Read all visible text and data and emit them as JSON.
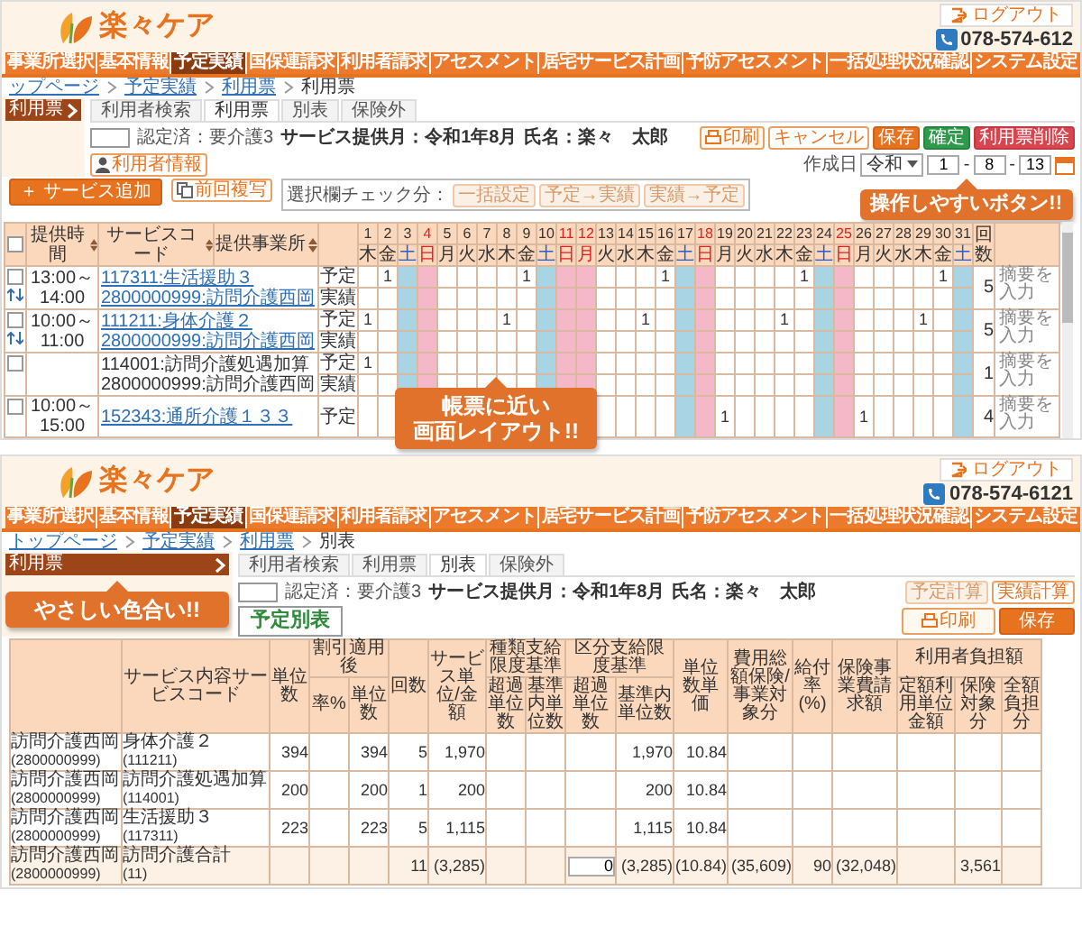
{
  "top_screen": {
    "header": {
      "logo_text": "楽々ケア",
      "logout": "ログアウト",
      "phone": "078-574-612"
    },
    "nav": [
      {
        "label": "事業所選択",
        "selected": false
      },
      {
        "label": "基本情報",
        "selected": false
      },
      {
        "label": "予定実績",
        "selected": true
      },
      {
        "label": "国保連請求",
        "selected": false
      },
      {
        "label": "利用者請求",
        "selected": false
      },
      {
        "label": "アセスメント",
        "selected": false
      },
      {
        "label": "居宅サービス計画",
        "selected": false
      },
      {
        "label": "予防アセスメント",
        "selected": false
      },
      {
        "label": "一括処理状況確認",
        "selected": false
      },
      {
        "label": "システム設定",
        "selected": false
      }
    ],
    "breadcrumb": [
      {
        "label": "ップページ",
        "link": true
      },
      {
        "label": "予定実績",
        "link": true
      },
      {
        "label": "利用票",
        "link": true
      },
      {
        "label": "利用票",
        "link": false
      }
    ],
    "sidebar": {
      "items": [
        {
          "label": "利用票",
          "selected": true
        }
      ]
    },
    "tabs": [
      {
        "label": "利用者検索",
        "selected": false
      },
      {
        "label": "利用票",
        "selected": true
      },
      {
        "label": "別表",
        "selected": false
      },
      {
        "label": "保険外",
        "selected": false
      }
    ],
    "info": {
      "status": "認定済：要介護3",
      "month": "サービス提供月：令和1年8月",
      "name": "氏名：楽々　太郎"
    },
    "buttons": [
      {
        "label": "印刷",
        "kind": "print"
      },
      {
        "label": "キャンセル",
        "kind": "outline"
      },
      {
        "label": "保存",
        "kind": "primary"
      },
      {
        "label": "確定",
        "kind": "confirm"
      },
      {
        "label": "利用票削除",
        "kind": "danger"
      }
    ],
    "user_info_button": "利用者情報",
    "created_date": {
      "label": "作成日",
      "parts": [
        {
          "kind": "select",
          "value": "令和"
        },
        {
          "kind": "field",
          "value": "1"
        },
        {
          "kind": "sep",
          "value": "-"
        },
        {
          "kind": "field",
          "value": "8"
        },
        {
          "kind": "sep",
          "value": "-"
        },
        {
          "kind": "field",
          "value": "13"
        }
      ]
    },
    "toolbar": {
      "add_button": "＋ サービス追加",
      "copy_button": "前回複写",
      "check_label": "選択欄チェック分：",
      "check_buttons": [
        "一括設定",
        "予定→実績",
        "実績→予定"
      ]
    },
    "button_callout": "操作しやすいボタン!!",
    "table": {
      "select_all_checked": false,
      "columns": [
        "提供時間",
        "サービスコード",
        "提供事業所"
      ],
      "count_header": "回数",
      "days": [
        {
          "day": "1",
          "weekday": "木",
          "kind": "weekday"
        },
        {
          "day": "2",
          "weekday": "金",
          "kind": "weekday"
        },
        {
          "day": "3",
          "weekday": "土",
          "kind": "saturday"
        },
        {
          "day": "4",
          "weekday": "日",
          "kind": "holiday"
        },
        {
          "day": "5",
          "weekday": "月",
          "kind": "weekday"
        },
        {
          "day": "6",
          "weekday": "火",
          "kind": "weekday"
        },
        {
          "day": "7",
          "weekday": "水",
          "kind": "weekday"
        },
        {
          "day": "8",
          "weekday": "木",
          "kind": "weekday"
        },
        {
          "day": "9",
          "weekday": "金",
          "kind": "weekday"
        },
        {
          "day": "10",
          "weekday": "土",
          "kind": "saturday"
        },
        {
          "day": "11",
          "weekday": "日",
          "kind": "holiday"
        },
        {
          "day": "12",
          "weekday": "月",
          "kind": "holiday"
        },
        {
          "day": "13",
          "weekday": "火",
          "kind": "weekday"
        },
        {
          "day": "14",
          "weekday": "水",
          "kind": "weekday"
        },
        {
          "day": "15",
          "weekday": "木",
          "kind": "weekday"
        },
        {
          "day": "16",
          "weekday": "金",
          "kind": "weekday"
        },
        {
          "day": "17",
          "weekday": "土",
          "kind": "saturday"
        },
        {
          "day": "18",
          "weekday": "日",
          "kind": "holiday"
        },
        {
          "day": "19",
          "weekday": "月",
          "kind": "weekday"
        },
        {
          "day": "20",
          "weekday": "火",
          "kind": "weekday"
        },
        {
          "day": "21",
          "weekday": "水",
          "kind": "weekday"
        },
        {
          "day": "22",
          "weekday": "木",
          "kind": "weekday"
        },
        {
          "day": "23",
          "weekday": "金",
          "kind": "weekday"
        },
        {
          "day": "24",
          "weekday": "土",
          "kind": "saturday"
        },
        {
          "day": "25",
          "weekday": "日",
          "kind": "holiday"
        },
        {
          "day": "26",
          "weekday": "月",
          "kind": "weekday"
        },
        {
          "day": "27",
          "weekday": "火",
          "kind": "weekday"
        },
        {
          "day": "28",
          "weekday": "水",
          "kind": "weekday"
        },
        {
          "day": "29",
          "weekday": "木",
          "kind": "weekday"
        },
        {
          "day": "30",
          "weekday": "金",
          "kind": "weekday"
        },
        {
          "day": "31",
          "weekday": "土",
          "kind": "saturday"
        }
      ],
      "rows": [
        {
          "checked": false,
          "movable": true,
          "time": "13:00～14:00",
          "code": "117311:生活援助３",
          "office": "2800000999:訪問介護西岡",
          "link": true,
          "plan_label": "予定",
          "actual_label": "実績",
          "plan": [
            {
              "kind": "empty"
            },
            {
              "kind": "mark",
              "value": "1"
            },
            {
              "kind": "empty"
            },
            {
              "kind": "empty"
            },
            {
              "kind": "empty"
            },
            {
              "kind": "empty"
            },
            {
              "kind": "empty"
            },
            {
              "kind": "empty"
            },
            {
              "kind": "mark",
              "value": "1"
            },
            {
              "kind": "empty"
            },
            {
              "kind": "empty"
            },
            {
              "kind": "empty"
            },
            {
              "kind": "empty"
            },
            {
              "kind": "empty"
            },
            {
              "kind": "empty"
            },
            {
              "kind": "mark",
              "value": "1"
            },
            {
              "kind": "empty"
            },
            {
              "kind": "empty"
            },
            {
              "kind": "empty"
            },
            {
              "kind": "empty"
            },
            {
              "kind": "empty"
            },
            {
              "kind": "empty"
            },
            {
              "kind": "mark",
              "value": "1"
            },
            {
              "kind": "empty"
            },
            {
              "kind": "empty"
            },
            {
              "kind": "empty"
            },
            {
              "kind": "empty"
            },
            {
              "kind": "empty"
            },
            {
              "kind": "empty"
            },
            {
              "kind": "mark",
              "value": "1"
            },
            {
              "kind": "empty"
            }
          ],
          "count": "5",
          "note_placeholder": "摘要を入力"
        },
        {
          "checked": false,
          "movable": true,
          "time": "10:00～11:00",
          "code": "111211:身体介護２",
          "office": "2800000999:訪問介護西岡",
          "link": true,
          "plan_label": "予定",
          "actual_label": "実績",
          "plan": [
            {
              "kind": "mark",
              "value": "1"
            },
            {
              "kind": "empty"
            },
            {
              "kind": "empty"
            },
            {
              "kind": "empty"
            },
            {
              "kind": "empty"
            },
            {
              "kind": "empty"
            },
            {
              "kind": "empty"
            },
            {
              "kind": "mark",
              "value": "1"
            },
            {
              "kind": "empty"
            },
            {
              "kind": "empty"
            },
            {
              "kind": "empty"
            },
            {
              "kind": "empty"
            },
            {
              "kind": "empty"
            },
            {
              "kind": "empty"
            },
            {
              "kind": "mark",
              "value": "1"
            },
            {
              "kind": "empty"
            },
            {
              "kind": "empty"
            },
            {
              "kind": "empty"
            },
            {
              "kind": "empty"
            },
            {
              "kind": "empty"
            },
            {
              "kind": "empty"
            },
            {
              "kind": "mark",
              "value": "1"
            },
            {
              "kind": "empty"
            },
            {
              "kind": "empty"
            },
            {
              "kind": "empty"
            },
            {
              "kind": "empty"
            },
            {
              "kind": "empty"
            },
            {
              "kind": "empty"
            },
            {
              "kind": "mark",
              "value": "1"
            },
            {
              "kind": "empty"
            },
            {
              "kind": "empty"
            }
          ],
          "count": "5",
          "note_placeholder": "摘要を入力"
        },
        {
          "checked": false,
          "code": "114001:訪問介護処遇加算",
          "office": "2800000999:訪問介護西岡",
          "link": false,
          "plan_label": "予定",
          "actual_label": "実績",
          "plan": [
            {
              "kind": "mark",
              "value": "1"
            },
            {
              "kind": "empty"
            },
            {
              "kind": "empty"
            },
            {
              "kind": "empty"
            },
            {
              "kind": "empty"
            },
            {
              "kind": "empty"
            },
            {
              "kind": "empty"
            },
            {
              "kind": "empty"
            },
            {
              "kind": "empty"
            },
            {
              "kind": "empty"
            },
            {
              "kind": "empty"
            },
            {
              "kind": "empty"
            },
            {
              "kind": "empty"
            },
            {
              "kind": "empty"
            },
            {
              "kind": "empty"
            },
            {
              "kind": "empty"
            },
            {
              "kind": "empty"
            },
            {
              "kind": "empty"
            },
            {
              "kind": "empty"
            },
            {
              "kind": "empty"
            },
            {
              "kind": "empty"
            },
            {
              "kind": "empty"
            },
            {
              "kind": "empty"
            },
            {
              "kind": "empty"
            },
            {
              "kind": "empty"
            },
            {
              "kind": "empty"
            },
            {
              "kind": "empty"
            },
            {
              "kind": "empty"
            },
            {
              "kind": "empty"
            },
            {
              "kind": "empty"
            },
            {
              "kind": "empty"
            }
          ],
          "count": "1",
          "note_placeholder": "摘要を入力"
        },
        {
          "checked": false,
          "time": "10:00～15:00",
          "code": "152343:通所介護１３３",
          "link": true,
          "plan_label": "予定",
          "plan": [
            {
              "kind": "empty"
            },
            {
              "kind": "empty"
            },
            {
              "kind": "empty"
            },
            {
              "kind": "empty"
            },
            {
              "kind": "empty"
            },
            {
              "kind": "empty"
            },
            {
              "kind": "empty"
            },
            {
              "kind": "empty"
            },
            {
              "kind": "empty"
            },
            {
              "kind": "empty"
            },
            {
              "kind": "empty"
            },
            {
              "kind": "empty"
            },
            {
              "kind": "empty"
            },
            {
              "kind": "empty"
            },
            {
              "kind": "empty"
            },
            {
              "kind": "empty"
            },
            {
              "kind": "empty"
            },
            {
              "kind": "empty"
            },
            {
              "kind": "mark",
              "value": "1"
            },
            {
              "kind": "empty"
            },
            {
              "kind": "empty"
            },
            {
              "kind": "empty"
            },
            {
              "kind": "empty"
            },
            {
              "kind": "empty"
            },
            {
              "kind": "empty"
            },
            {
              "kind": "mark",
              "value": "1"
            },
            {
              "kind": "empty"
            },
            {
              "kind": "empty"
            },
            {
              "kind": "empty"
            },
            {
              "kind": "empty"
            },
            {
              "kind": "empty"
            }
          ],
          "count": "4",
          "note_placeholder": "摘要を入力"
        }
      ]
    },
    "layout_callout": [
      "帳票に近い",
      "画面レイアウト!!"
    ]
  },
  "bottom_screen": {
    "header": {
      "logo_text": "楽々ケア",
      "logout": "ログアウト",
      "phone": "078-574-6121"
    },
    "nav": [
      {
        "label": "事業所選択",
        "selected": false
      },
      {
        "label": "基本情報",
        "selected": false
      },
      {
        "label": "予定実績",
        "selected": true
      },
      {
        "label": "国保連請求",
        "selected": false
      },
      {
        "label": "利用者請求",
        "selected": false
      },
      {
        "label": "アセスメント",
        "selected": false
      },
      {
        "label": "居宅サービス計画",
        "selected": false
      },
      {
        "label": "予防アセスメント",
        "selected": false
      },
      {
        "label": "一括処理状況確認",
        "selected": false
      },
      {
        "label": "システム設定",
        "selected": false
      }
    ],
    "breadcrumb": [
      {
        "label": "トップページ",
        "link": true
      },
      {
        "label": "予定実績",
        "link": true
      },
      {
        "label": "利用票",
        "link": true
      },
      {
        "label": "別表",
        "link": false
      }
    ],
    "sidebar": {
      "items": [
        {
          "label": "利用票",
          "selected": true
        }
      ]
    },
    "color_callout": "やさしい色合い!!",
    "tabs": [
      {
        "label": "利用者検索",
        "selected": false
      },
      {
        "label": "利用票",
        "selected": false
      },
      {
        "label": "別表",
        "selected": true
      },
      {
        "label": "保険外",
        "selected": false
      }
    ],
    "info": {
      "status": "認定済：要介護3",
      "month": "サービス提供月：令和1年8月",
      "name": "氏名：楽々　太郎"
    },
    "calc_buttons": [
      {
        "label": "予定計算",
        "kind": "disabled"
      },
      {
        "label": "実績計算",
        "kind": "outline"
      }
    ],
    "section_title": "予定別表",
    "buttons": [
      {
        "label": "印刷",
        "kind": "print"
      },
      {
        "label": "保存",
        "kind": "primary"
      }
    ],
    "table": {
      "header": [
        {
          "label": "サービス内容サービスコード"
        },
        {
          "label": "単位数"
        },
        {
          "label": "割引適用後",
          "children": [
            {
              "label": "率%"
            },
            {
              "label": "単位数"
            }
          ]
        },
        {
          "label": "回数"
        },
        {
          "label": "サービス単位/金額"
        },
        {
          "label": "種類支給限度基準",
          "children": [
            {
              "label": "超過単位数"
            },
            {
              "label": "基準内単位数"
            }
          ]
        },
        {
          "label": "区分支給限度基準",
          "children": [
            {
              "label": "超過単位数"
            },
            {
              "label": "基準内単位数"
            }
          ]
        },
        {
          "label": "単位数単価"
        },
        {
          "label": "費用総額保険/事業対象分"
        },
        {
          "label": "給付率(%)"
        },
        {
          "label": "保険事業費請求額"
        },
        {
          "label": "利用者負担額",
          "children": [
            {
              "label": "定額利用単位金額"
            },
            {
              "label": "保険対象分"
            },
            {
              "label": "全額負担分"
            }
          ]
        }
      ],
      "rows": [
        {
          "kind": "item",
          "office": "訪問介護西岡",
          "office_code": "(2800000999)",
          "service": "身体介護２",
          "service_code": "(111211)",
          "values": {
            "units": "394",
            "disc_units": "394",
            "times": "5",
            "svc_amount": "1,970",
            "cat_within": "1,970",
            "unit_price": "10.84"
          }
        },
        {
          "kind": "item",
          "office": "訪問介護西岡",
          "office_code": "(2800000999)",
          "service": "訪問介護処遇加算",
          "service_code": "(114001)",
          "values": {
            "units": "200",
            "disc_units": "200",
            "times": "1",
            "svc_amount": "200",
            "cat_within": "200",
            "unit_price": "10.84"
          }
        },
        {
          "kind": "item",
          "office": "訪問介護西岡",
          "office_code": "(2800000999)",
          "service": "生活援助３",
          "service_code": "(117311)",
          "values": {
            "units": "223",
            "disc_units": "223",
            "times": "5",
            "svc_amount": "1,115",
            "cat_within": "1,115",
            "unit_price": "10.84"
          }
        },
        {
          "kind": "total",
          "office": "訪問介護西岡",
          "office_code": "(2800000999)",
          "service": "訪問介護合計",
          "service_code": "(11)",
          "values": {
            "times": "11",
            "svc_amount": "(3,285)",
            "cat_over": {
              "field": "0"
            },
            "cat_within": "(3,285)",
            "unit_price": "(10.84)",
            "total_cost": "(35,609)",
            "benefit_rate": "90",
            "claim": "(32,048)",
            "ins_part": "3,561"
          }
        }
      ]
    }
  }
}
